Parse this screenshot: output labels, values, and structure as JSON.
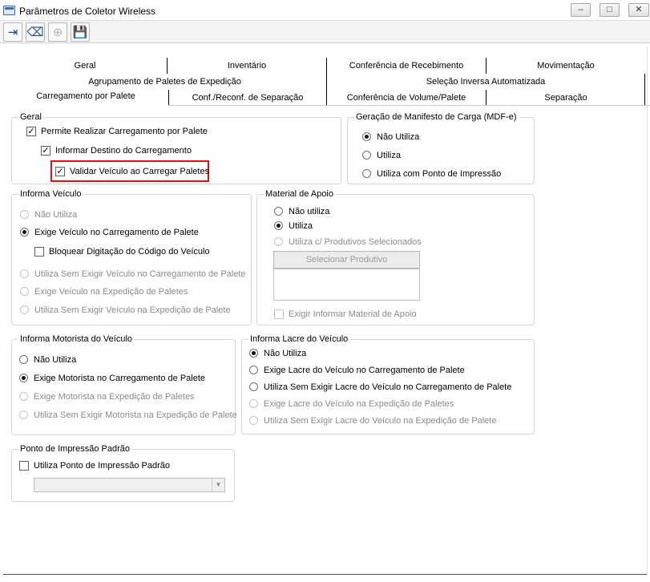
{
  "window": {
    "title": "Parâmetros de Coletor Wireless",
    "min": "–",
    "max": "□",
    "close": "✕"
  },
  "toolbar": {
    "icons": [
      "exit-icon",
      "eraser-icon",
      "add-icon",
      "save-icon"
    ]
  },
  "tabs": {
    "row1": [
      "Geral",
      "Inventário",
      "Conferência de Recebimento",
      "Movimentação"
    ],
    "row2": [
      "Agrupamento de Paletes de Expedição",
      "Seleção Inversa Automatizada"
    ],
    "row3": [
      "Carregamento por Palete",
      "Conf./Reconf. de Separação",
      "Conferência de Volume/Palete",
      "Separação"
    ]
  },
  "geral": {
    "legend": "Geral",
    "permite": "Permite Realizar Carregamento por Palete",
    "informar_destino": "Informar Destino do Carregamento",
    "validar_veiculo": "Validar Veículo ao Carregar Paletes"
  },
  "mdfe": {
    "legend": "Geração de Manifesto de Carga (MDF-e)",
    "options": [
      "Não Utiliza",
      "Utiliza",
      "Utiliza com Ponto de Impressão"
    ]
  },
  "veiculo": {
    "legend": "Informa Veículo",
    "nao_utiliza": "Não Utiliza",
    "exige_carregamento": "Exige Veículo no Carregamento de Palete",
    "bloquear": "Bloquear Digitação do Código do Veículo",
    "sem_exigir_carregamento": "Utiliza Sem Exigir Veículo no Carregamento de Palete",
    "exige_expedicao": "Exige Veículo na Expedição de Paletes",
    "sem_exigir_expedicao": "Utiliza Sem Exigir Veículo na Expedição de Palete"
  },
  "material": {
    "legend": "Material de Apoio",
    "nao_utiliza": "Não utiliza",
    "utiliza": "Utiliza",
    "produtivos": "Utiliza c/ Produtivos Selecionados",
    "selecionar": "Selecionar Produtivo",
    "exigir": "Exigir Informar Material de Apoio"
  },
  "motorista": {
    "legend": "Informa Motorista do Veículo",
    "options": [
      "Não Utiliza",
      "Exige Motorista no Carregamento de Palete",
      "Exige Motorista na Expedição de Paletes",
      "Utiliza Sem Exigir Motorista na Expedição de Palete"
    ]
  },
  "lacre": {
    "legend": "Informa Lacre do Veículo",
    "options": [
      "Não Utiliza",
      "Exige Lacre do Veículo no Carregamento de Palete",
      "Utiliza Sem Exigir Lacre do Veículo no Carregamento de Palete",
      "Exige Lacre do Veículo na Expedição de Paletes",
      "Utiliza Sem Exigir Lacre do Veículo na Expedição de Palete"
    ]
  },
  "impressao": {
    "legend": "Ponto de Impressão Padrão",
    "utiliza": "Utiliza Ponto de Impressão Padrão",
    "combo_value": ""
  },
  "colors": {
    "highlight": "#e11111",
    "accent": "#1f4e8c"
  }
}
